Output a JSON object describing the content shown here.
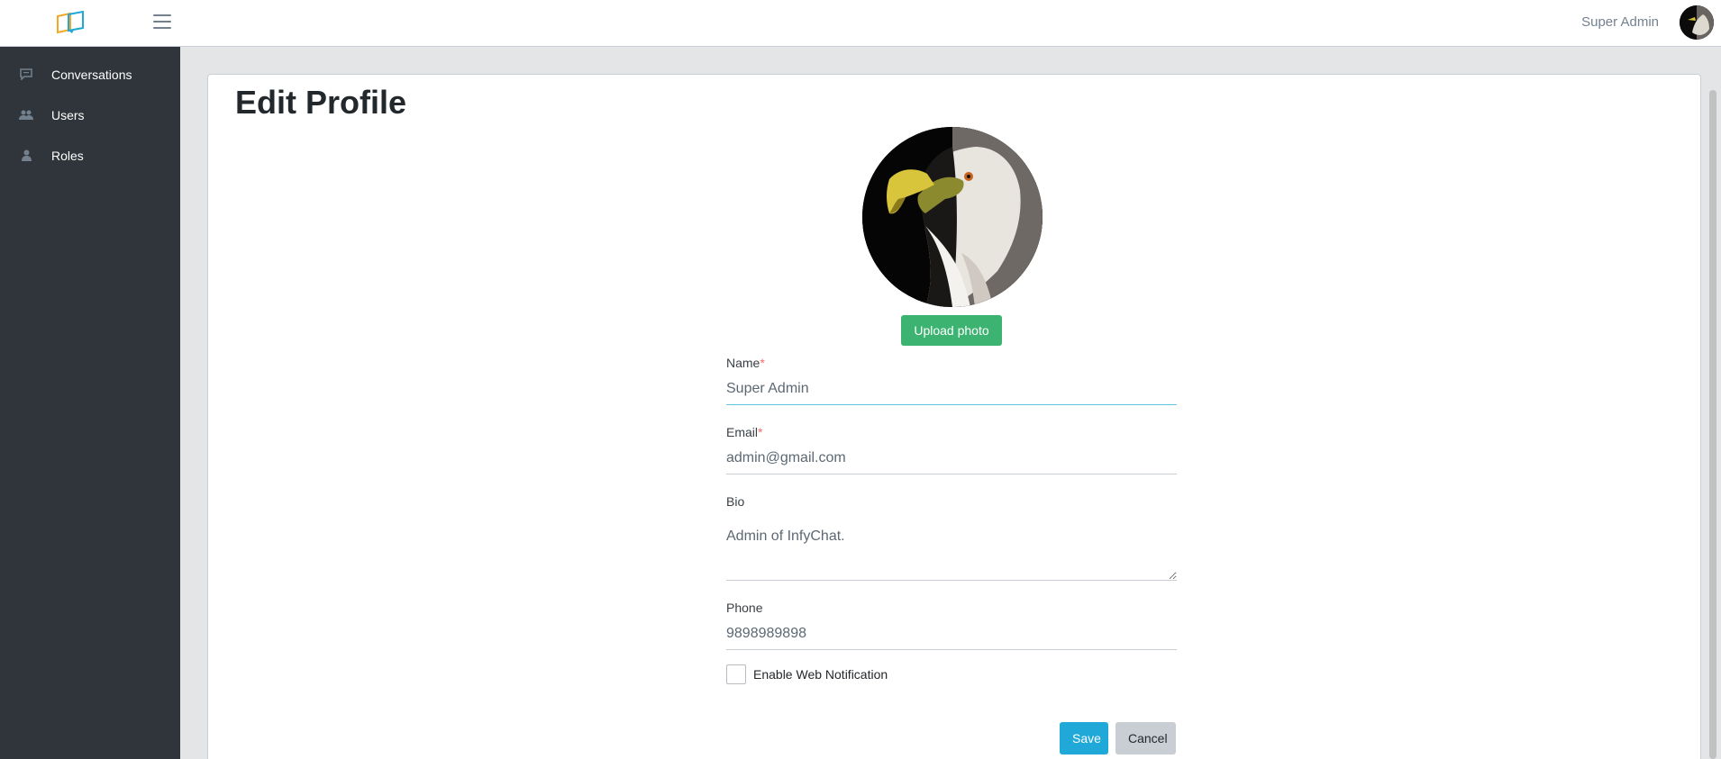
{
  "header": {
    "logo_icon": "chat-screens-logo",
    "menu_icon": "hamburger-icon",
    "user_name": "Super Admin"
  },
  "sidebar": {
    "items": [
      {
        "label": "Conversations",
        "icon": "comment-icon"
      },
      {
        "label": "Users",
        "icon": "users-icon"
      },
      {
        "label": "Roles",
        "icon": "user-icon"
      }
    ]
  },
  "page": {
    "title": "Edit Profile",
    "upload_label": "Upload photo"
  },
  "form": {
    "name_label": "Name",
    "name_value": "Super Admin",
    "email_label": "Email",
    "email_value": "admin@gmail.com",
    "required_mark": "*",
    "bio_label": "Bio",
    "bio_value": "Admin of InfyChat.",
    "phone_label": "Phone",
    "phone_value": "9898989898",
    "notification_label": "Enable Web Notification",
    "notification_checked": false
  },
  "actions": {
    "save_label": "Save",
    "cancel_label": "Cancel"
  },
  "colors": {
    "sidebar_bg": "#2f353a",
    "upload_green": "#3cb371",
    "save_blue": "#20a8d8",
    "cancel_gray": "#c8ced3"
  }
}
